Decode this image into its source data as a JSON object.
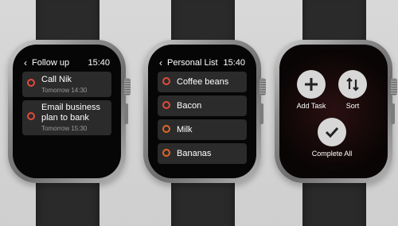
{
  "watches": [
    {
      "header": {
        "title": "Follow up",
        "time": "15:40"
      },
      "items": [
        {
          "label": "Call Nik",
          "sub": "Tomorrow 14:30"
        },
        {
          "label_line1": "Email business",
          "label_line2": "plan to bank",
          "sub": "Tomorrow 15:30"
        }
      ]
    },
    {
      "header": {
        "title": "Personal List",
        "time": "15:40"
      },
      "items": [
        {
          "label": "Coffee beans"
        },
        {
          "label": "Bacon"
        },
        {
          "label": "Milk"
        },
        {
          "label": "Bananas"
        }
      ]
    },
    {
      "menu": {
        "add_task": "Add Task",
        "sort": "Sort",
        "complete_all": "Complete All"
      }
    }
  ],
  "colors": {
    "accent_red": "#e04b3a",
    "accent_orange": "#e0662a",
    "row_bg": "#2b2b2b"
  },
  "icons": [
    "back-chevron-icon",
    "plus-icon",
    "sort-arrows-icon",
    "checkmark-icon"
  ]
}
